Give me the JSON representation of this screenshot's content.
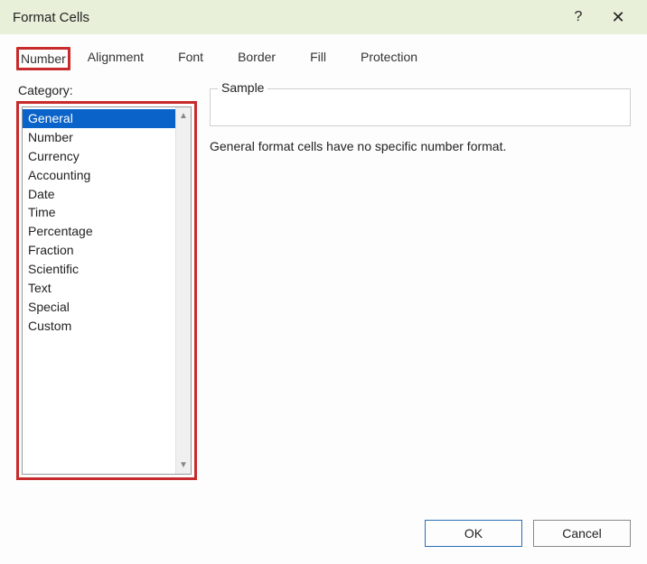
{
  "title": "Format Cells",
  "titlebar": {
    "help_glyph": "?",
    "close_glyph": "✕"
  },
  "tabs": [
    {
      "label": "Number",
      "active": true
    },
    {
      "label": "Alignment",
      "active": false
    },
    {
      "label": "Font",
      "active": false
    },
    {
      "label": "Border",
      "active": false
    },
    {
      "label": "Fill",
      "active": false
    },
    {
      "label": "Protection",
      "active": false
    }
  ],
  "category": {
    "label": "Category:",
    "items": [
      "General",
      "Number",
      "Currency",
      "Accounting",
      "Date",
      "Time",
      "Percentage",
      "Fraction",
      "Scientific",
      "Text",
      "Special",
      "Custom"
    ],
    "selected_index": 0
  },
  "sample": {
    "label": "Sample",
    "value": ""
  },
  "description": "General format cells have no specific number format.",
  "buttons": {
    "ok": "OK",
    "cancel": "Cancel"
  },
  "scroll": {
    "up_glyph": "▲",
    "down_glyph": "▼"
  }
}
